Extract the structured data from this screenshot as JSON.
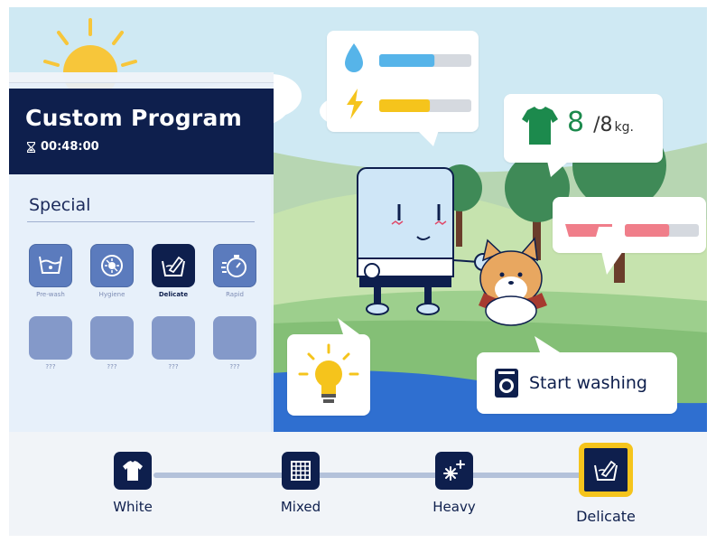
{
  "program": {
    "title": "Custom Program",
    "timer": "00:48:00",
    "section_title": "Special",
    "options": [
      {
        "label": "Pre-wash",
        "icon": "prewash-icon",
        "selected": false
      },
      {
        "label": "Hygiene",
        "icon": "hygiene-icon",
        "selected": false
      },
      {
        "label": "Delicate",
        "icon": "delicate-icon",
        "selected": true
      },
      {
        "label": "Rapid",
        "icon": "rapid-icon",
        "selected": false
      },
      {
        "label": "???",
        "icon": "",
        "selected": false
      },
      {
        "label": "???",
        "icon": "",
        "selected": false
      },
      {
        "label": "???",
        "icon": "",
        "selected": false
      },
      {
        "label": "???",
        "icon": "",
        "selected": false
      }
    ]
  },
  "status": {
    "water_level": 0.6,
    "energy_level": 0.55,
    "detergent_level": 0.6,
    "weight_value": "8",
    "weight_separator": "/",
    "weight_max": "8",
    "weight_unit": "kg."
  },
  "actions": {
    "start_label": "Start washing"
  },
  "modes": [
    {
      "label": "White",
      "icon": "tshirt-icon",
      "selected": false
    },
    {
      "label": "Mixed",
      "icon": "fabric-grid-icon",
      "selected": false
    },
    {
      "label": "Heavy",
      "icon": "sparkle-icon",
      "selected": false
    },
    {
      "label": "Delicate",
      "icon": "delicate-icon",
      "selected": true
    }
  ],
  "colors": {
    "navy": "#0e1f4d",
    "water_blue": "#56b4e9",
    "energy_yellow": "#f5c41c",
    "detergent_pink": "#f07e8a",
    "weight_green": "#1c8a4d"
  }
}
